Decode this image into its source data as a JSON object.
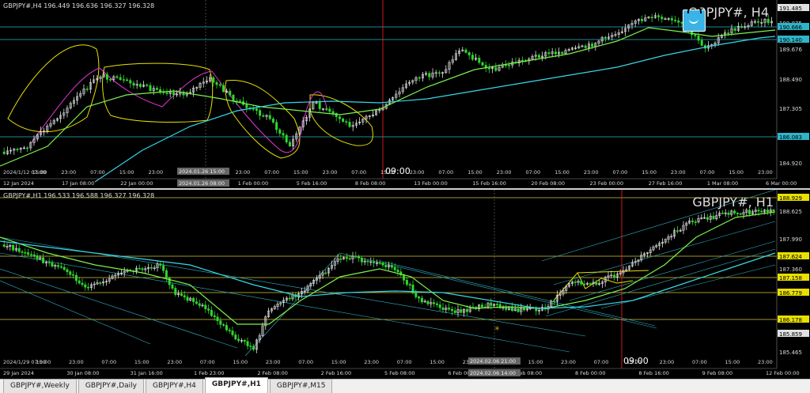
{
  "charts": {
    "h4": {
      "info": "GBPJPY#,H4 196.449 196.636 196.327 196.328",
      "big_label": "GBPJPY#, H4",
      "price_labels": [
        {
          "text": "191.485",
          "style": "white"
        },
        {
          "text": "190.875",
          "style": "plain"
        },
        {
          "text": "190.666",
          "style": "cyan"
        },
        {
          "text": "190.140",
          "style": "cyan"
        },
        {
          "text": "189.676",
          "style": "plain"
        },
        {
          "text": "188.490",
          "style": "plain"
        },
        {
          "text": "187.305",
          "style": "plain"
        },
        {
          "text": "186.083",
          "style": "cyan"
        },
        {
          "text": "184.920",
          "style": "plain"
        }
      ],
      "time_labels": [
        "12 Jan 2024",
        "17 Jan 08:00",
        "22 Jan 00:00",
        "24 Jan 16:00",
        "1 Feb 00:00",
        "5 Feb 16:00",
        "8 Feb 08:00",
        "13 Feb 00:00",
        "15 Feb 16:00",
        "20 Feb 08:00",
        "23 Feb 00:00",
        "27 Feb 16:00",
        "1 Mar 08:00",
        "6 Mar 00:00"
      ],
      "hour_labels": [
        "2024/1/12 07:00",
        "15:00",
        "23:00",
        "07:00",
        "15:00",
        "23:00",
        "07:00",
        "15:00",
        "23:00",
        "07:00",
        "15:00",
        "23:00",
        "07:00",
        "15:00",
        "23:00",
        "07:00",
        "15:00",
        "23:00",
        "07:00",
        "15:00",
        "23:00",
        "07:00",
        "15:00",
        "23:00",
        "07:00",
        "15:00",
        "23:00"
      ],
      "crosshair_labels": [
        "2024.01.26 15:00",
        "2024.01.26 08:00"
      ],
      "time_marker": "09:00"
    },
    "h1": {
      "info": "GBPJPY#,H1 196.533 196.588 196.327 196.328",
      "big_label": "GBPJPY#, H1",
      "price_labels": [
        {
          "text": "188.929",
          "style": "yellow"
        },
        {
          "text": "188.625",
          "style": "plain"
        },
        {
          "text": "187.990",
          "style": "plain"
        },
        {
          "text": "187.624",
          "style": "yellow"
        },
        {
          "text": "187.360",
          "style": "plain"
        },
        {
          "text": "187.158",
          "style": "yellow"
        },
        {
          "text": "186.779",
          "style": "yellow"
        },
        {
          "text": "186.178",
          "style": "yellow"
        },
        {
          "text": "185.859",
          "style": "white"
        },
        {
          "text": "185.465",
          "style": "plain"
        }
      ],
      "time_labels": [
        "29 Jan 2024",
        "30 Jan 08:00",
        "31 Jan 16:00",
        "1 Feb 23:00",
        "2 Feb 08:00",
        "2 Feb 16:00",
        "5 Feb 08:00",
        "6 Feb 00:00",
        "7 Feb 08:00",
        "8 Feb 00:00",
        "8 Feb 16:00",
        "9 Feb 08:00",
        "12 Feb 00:00"
      ],
      "hour_labels": [
        "2024/1/29 07:00",
        "15:00",
        "23:00",
        "07:00",
        "15:00",
        "23:00",
        "07:00",
        "15:00",
        "23:00",
        "07:00",
        "15:00",
        "23:00",
        "07:00",
        "15:00",
        "23:00",
        "07:00",
        "15:00",
        "23:00",
        "07:00",
        "15:00",
        "23:00",
        "07:00",
        "15:00",
        "23:00"
      ],
      "crosshair_labels": [
        "2024.02.06 21:00",
        "2024.02.06 14:00"
      ],
      "time_marker": "09:00"
    }
  },
  "tabs": [
    {
      "label": "GBPJPY#,Weekly",
      "active": false
    },
    {
      "label": "GBPJPY#,Daily",
      "active": false
    },
    {
      "label": "GBPJPY#,H4",
      "active": false
    },
    {
      "label": "GBPJPY#,H1",
      "active": true
    },
    {
      "label": "GBPJPY#,M15",
      "active": false
    }
  ],
  "colors": {
    "background": "#000000",
    "bull_candle": "#e0e0e0",
    "bear_candle": "#2fd62f",
    "ma_fast": "#7cf24a",
    "ma_slow": "#37d6e8",
    "envelope": "#e8e000",
    "magenta": "#e234d6",
    "level_cyan": "#2fb4c9",
    "level_yellow": "#d8c63a",
    "crosshair_red": "#ff2020"
  }
}
